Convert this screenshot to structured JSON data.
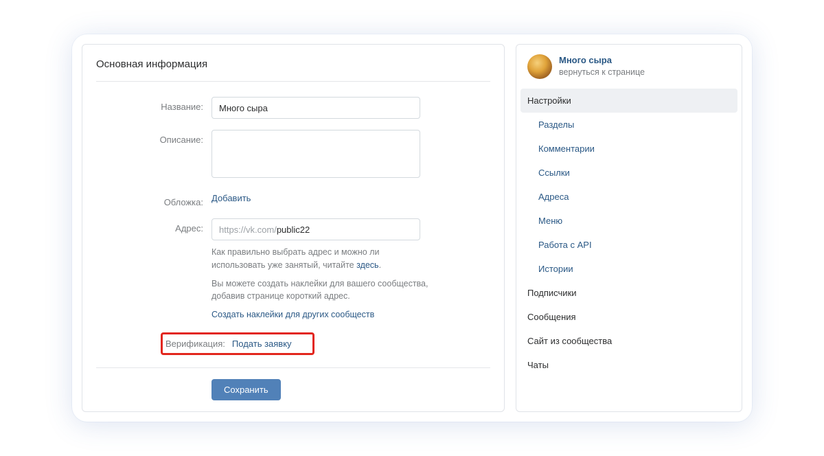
{
  "main": {
    "title": "Основная информация",
    "labels": {
      "name": "Название:",
      "description": "Описание:",
      "cover": "Обложка:",
      "address": "Адрес:",
      "verification": "Верификация:"
    },
    "name_value": "Много сыра",
    "description_value": "",
    "cover_action": "Добавить",
    "address_prefix": "https://vk.com/",
    "address_value": "public22",
    "address_help1_a": "Как правильно выбрать адрес и можно ли использовать уже занятый, читайте ",
    "address_help1_link": "здесь",
    "address_help1_b": ".",
    "address_help2": "Вы можете создать наклейки для вашего сообщества, добавив странице короткий адрес.",
    "address_help3_link": "Создать наклейки для других сообществ",
    "verification_action": "Подать заявку",
    "save_label": "Сохранить"
  },
  "sidebar": {
    "community_name": "Много сыра",
    "return_label": "вернуться к странице",
    "items": [
      {
        "label": "Настройки",
        "kind": "active"
      },
      {
        "label": "Разделы",
        "kind": "sub"
      },
      {
        "label": "Комментарии",
        "kind": "sub"
      },
      {
        "label": "Ссылки",
        "kind": "sub"
      },
      {
        "label": "Адреса",
        "kind": "sub"
      },
      {
        "label": "Меню",
        "kind": "sub"
      },
      {
        "label": "Работа с API",
        "kind": "sub"
      },
      {
        "label": "Истории",
        "kind": "sub"
      },
      {
        "label": "Подписчики",
        "kind": "top"
      },
      {
        "label": "Сообщения",
        "kind": "top"
      },
      {
        "label": "Сайт из сообщества",
        "kind": "top"
      },
      {
        "label": "Чаты",
        "kind": "top"
      }
    ]
  }
}
